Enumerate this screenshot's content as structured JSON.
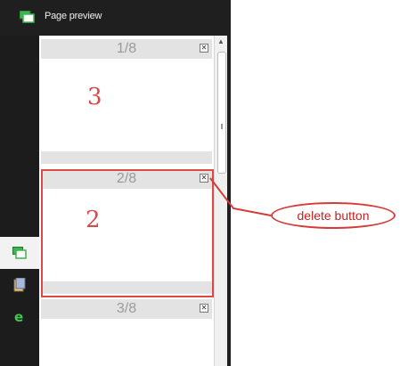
{
  "panel": {
    "title": "Page preview",
    "icon": "page-preview-icon"
  },
  "rail": {
    "tabs": [
      {
        "icon": "page-preview-tab-icon",
        "active": true
      },
      {
        "icon": "notes-tab-icon",
        "active": false
      },
      {
        "icon": "browser-e-tab-icon",
        "active": false
      }
    ]
  },
  "pages": [
    {
      "label": "1/8",
      "sketch": "3",
      "selected": false
    },
    {
      "label": "2/8",
      "sketch": "2",
      "selected": true
    },
    {
      "label": "3/8",
      "sketch": "",
      "selected": false
    }
  ],
  "callout": {
    "text": "delete button"
  },
  "colors": {
    "dark": "#1f1f1f",
    "highlight": "#e04848",
    "page_header": "#e3e3e3",
    "callout": "#c81e1e"
  }
}
